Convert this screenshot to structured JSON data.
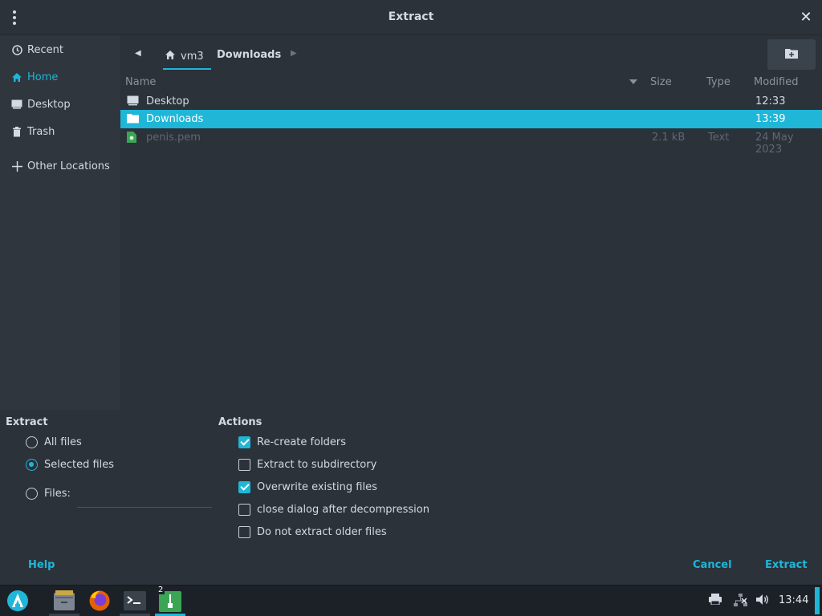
{
  "window": {
    "title": "Extract",
    "close_glyph": "✕"
  },
  "sidebar": {
    "items": [
      {
        "label": "Recent",
        "icon": "clock-icon",
        "active": false
      },
      {
        "label": "Home",
        "icon": "home-icon",
        "active": true
      },
      {
        "label": "Desktop",
        "icon": "desktop-icon",
        "active": false
      },
      {
        "label": "Trash",
        "icon": "trash-icon",
        "active": false
      },
      {
        "label": "Other Locations",
        "icon": "plus-icon",
        "active": false
      }
    ]
  },
  "pathbar": {
    "home_label": "vm3",
    "current_label": "Downloads"
  },
  "columns": {
    "name": "Name",
    "size": "Size",
    "type": "Type",
    "modified": "Modified"
  },
  "files": [
    {
      "name": "Desktop",
      "size": "",
      "type": "",
      "modified": "12:33",
      "kind": "folder"
    },
    {
      "name": "Downloads",
      "size": "",
      "type": "",
      "modified": "13:39",
      "kind": "folder"
    },
    {
      "name": "penis.pem",
      "size": "2.1 kB",
      "type": "Text",
      "modified": "24 May 2023",
      "kind": "file"
    }
  ],
  "extract": {
    "heading": "Extract",
    "all_files": "All files",
    "selected_files": "Selected files",
    "files_label": "Files:"
  },
  "actions": {
    "heading": "Actions",
    "recreate_folders": "Re-create folders",
    "extract_subdir": "Extract to subdirectory",
    "overwrite": "Overwrite existing files",
    "close_dialog": "close dialog after decompression",
    "no_older": "Do not extract older files"
  },
  "buttons": {
    "help": "Help",
    "cancel": "Cancel",
    "extract": "Extract"
  },
  "taskbar": {
    "badge": "2",
    "clock": "13:44"
  },
  "colors": {
    "accent": "#1fb6d8",
    "bg": "#2b323a",
    "sidebar": "#2f363e"
  }
}
